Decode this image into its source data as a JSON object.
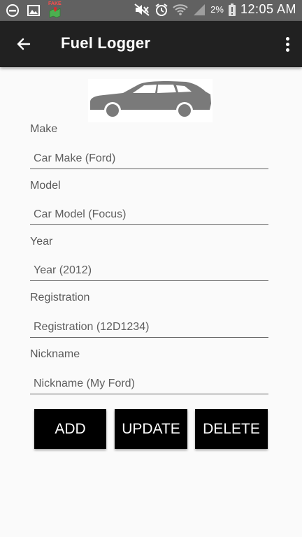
{
  "status_bar": {
    "fake_badge": "FAKE",
    "battery_percent": "2%",
    "battery_alert": "!",
    "time": "12:05 AM",
    "icons": [
      "dnd-icon",
      "gallery-icon",
      "fake-gps-icon",
      "mute-icon",
      "alarm-icon",
      "wifi-icon",
      "signal-icon",
      "battery-alert-icon"
    ]
  },
  "app_bar": {
    "title": "Fuel Logger",
    "back_icon": "arrow-back-icon",
    "overflow_icon": "more-vert-icon"
  },
  "form": {
    "make": {
      "label": "Make",
      "placeholder": "Car Make (Ford)"
    },
    "model": {
      "label": "Model",
      "placeholder": "Car Model (Focus)"
    },
    "year": {
      "label": "Year",
      "placeholder": "Year (2012)"
    },
    "registration": {
      "label": "Registration",
      "placeholder": "Registration (12D1234)"
    },
    "nickname": {
      "label": "Nickname",
      "placeholder": "Nickname (My Ford)"
    }
  },
  "buttons": {
    "add": "ADD",
    "update": "UPDATE",
    "delete": "DELETE"
  },
  "colors": {
    "status_bar": "#616161",
    "app_bar": "#212121",
    "background": "#fafafa",
    "button": "#000000",
    "car_silhouette": "#7a7a7a"
  }
}
